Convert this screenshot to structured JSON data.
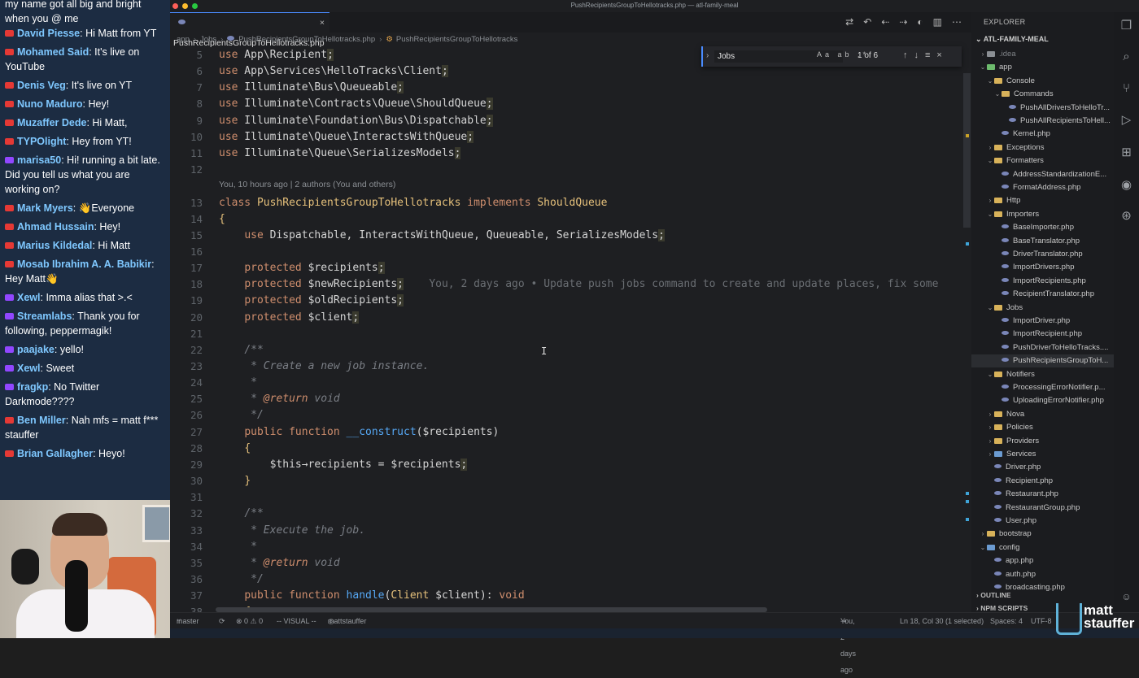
{
  "chat": {
    "intro": "my name got all big and bright when you @ me",
    "messages": [
      {
        "platform": "yt",
        "author": "David Piesse",
        "text": "Hi Matt from YT"
      },
      {
        "platform": "yt",
        "author": "Mohamed Said",
        "text": "It's live on YouTube"
      },
      {
        "platform": "yt",
        "author": "Denis Veg",
        "text": "It's live on YT"
      },
      {
        "platform": "yt",
        "author": "Nuno Maduro",
        "text": "Hey!"
      },
      {
        "platform": "yt",
        "author": "Muzaffer Dede",
        "text": "Hi Matt,"
      },
      {
        "platform": "yt",
        "author": "TYPOlight",
        "text": "Hey from YT!"
      },
      {
        "platform": "tw",
        "author": "marisa50",
        "text": "Hi! running a bit late. Did you tell us what you are working on?"
      },
      {
        "platform": "yt",
        "author": "Mark Myers",
        "text": "👋Everyone"
      },
      {
        "platform": "yt",
        "author": "Ahmad Hussain",
        "text": "Hey!"
      },
      {
        "platform": "yt",
        "author": "Marius Kildedal",
        "text": "Hi Matt"
      },
      {
        "platform": "yt",
        "author": "Mosab Ibrahim A. A. Babikir",
        "text": "Hey Matt👋"
      },
      {
        "platform": "tw",
        "author": "Xewl",
        "text": "Imma alias that >.<"
      },
      {
        "platform": "tw",
        "author": "Streamlabs",
        "text": "Thank you for following, peppermagik!"
      },
      {
        "platform": "tw",
        "author": "paajake",
        "text": "yello!"
      },
      {
        "platform": "tw",
        "author": "Xewl",
        "text": "Sweet"
      },
      {
        "platform": "tw",
        "author": "fragkp",
        "text": "No Twitter Darkmode????"
      },
      {
        "platform": "yt",
        "author": "Ben Miller",
        "text": "Nah mfs = matt f*** stauffer"
      },
      {
        "platform": "yt",
        "author": "Brian Gallagher",
        "text": "Heyo!"
      }
    ]
  },
  "window": {
    "title": "PushRecipientsGroupToHellotracks.php — atl-family-meal"
  },
  "tab": {
    "label": "PushRecipientsGroupToHellotracks.php"
  },
  "breadcrumb": [
    "app",
    "Jobs",
    "PushRecipientsGroupToHellotracks.php",
    "PushRecipientsGroupToHellotracks"
  ],
  "find": {
    "query": "Jobs",
    "count": "1 of 6"
  },
  "codelens": "You, 10 hours ago | 2 authors (You and others)",
  "blame": "You, 2 days ago • Update push jobs command to create and update places, fix some",
  "explorer": {
    "header": "EXPLORER",
    "project": "ATL-FAMILY-MEAL",
    "items": [
      {
        "label": ".idea",
        "depth": 1,
        "kind": "folder-gray",
        "arrow": "›",
        "muted": true
      },
      {
        "label": "app",
        "depth": 1,
        "kind": "folder-green",
        "arrow": "⌄"
      },
      {
        "label": "Console",
        "depth": 2,
        "kind": "folder",
        "arrow": "⌄"
      },
      {
        "label": "Commands",
        "depth": 3,
        "kind": "folder",
        "arrow": "⌄"
      },
      {
        "label": "PushAllDriversToHelloTr...",
        "depth": 4,
        "kind": "php"
      },
      {
        "label": "PushAllRecipientsToHell...",
        "depth": 4,
        "kind": "php"
      },
      {
        "label": "Kernel.php",
        "depth": 3,
        "kind": "php"
      },
      {
        "label": "Exceptions",
        "depth": 2,
        "kind": "folder",
        "arrow": "›"
      },
      {
        "label": "Formatters",
        "depth": 2,
        "kind": "folder",
        "arrow": "⌄"
      },
      {
        "label": "AddressStandardizationE...",
        "depth": 3,
        "kind": "php"
      },
      {
        "label": "FormatAddress.php",
        "depth": 3,
        "kind": "php"
      },
      {
        "label": "Http",
        "depth": 2,
        "kind": "folder",
        "arrow": "›"
      },
      {
        "label": "Importers",
        "depth": 2,
        "kind": "folder",
        "arrow": "⌄"
      },
      {
        "label": "BaseImporter.php",
        "depth": 3,
        "kind": "php"
      },
      {
        "label": "BaseTranslator.php",
        "depth": 3,
        "kind": "php"
      },
      {
        "label": "DriverTranslator.php",
        "depth": 3,
        "kind": "php"
      },
      {
        "label": "ImportDrivers.php",
        "depth": 3,
        "kind": "php"
      },
      {
        "label": "ImportRecipients.php",
        "depth": 3,
        "kind": "php"
      },
      {
        "label": "RecipientTranslator.php",
        "depth": 3,
        "kind": "php"
      },
      {
        "label": "Jobs",
        "depth": 2,
        "kind": "folder",
        "arrow": "⌄"
      },
      {
        "label": "ImportDriver.php",
        "depth": 3,
        "kind": "php"
      },
      {
        "label": "ImportRecipient.php",
        "depth": 3,
        "kind": "php"
      },
      {
        "label": "PushDriverToHelloTracks....",
        "depth": 3,
        "kind": "php"
      },
      {
        "label": "PushRecipientsGroupToH...",
        "depth": 3,
        "kind": "php",
        "selected": true
      },
      {
        "label": "Notifiers",
        "depth": 2,
        "kind": "folder",
        "arrow": "⌄"
      },
      {
        "label": "ProcessingErrorNotifier.p...",
        "depth": 3,
        "kind": "php"
      },
      {
        "label": "UploadingErrorNotifier.php",
        "depth": 3,
        "kind": "php"
      },
      {
        "label": "Nova",
        "depth": 2,
        "kind": "folder",
        "arrow": "›"
      },
      {
        "label": "Policies",
        "depth": 2,
        "kind": "folder",
        "arrow": "›"
      },
      {
        "label": "Providers",
        "depth": 2,
        "kind": "folder",
        "arrow": "›"
      },
      {
        "label": "Services",
        "depth": 2,
        "kind": "folder-blue",
        "arrow": "›"
      },
      {
        "label": "Driver.php",
        "depth": 2,
        "kind": "php"
      },
      {
        "label": "Recipient.php",
        "depth": 2,
        "kind": "php"
      },
      {
        "label": "Restaurant.php",
        "depth": 2,
        "kind": "php"
      },
      {
        "label": "RestaurantGroup.php",
        "depth": 2,
        "kind": "php"
      },
      {
        "label": "User.php",
        "depth": 2,
        "kind": "php"
      },
      {
        "label": "bootstrap",
        "depth": 1,
        "kind": "folder",
        "arrow": "›"
      },
      {
        "label": "config",
        "depth": 1,
        "kind": "folder-blue",
        "arrow": "⌄"
      },
      {
        "label": "app.php",
        "depth": 2,
        "kind": "php"
      },
      {
        "label": "auth.php",
        "depth": 2,
        "kind": "php"
      },
      {
        "label": "broadcasting.php",
        "depth": 2,
        "kind": "php"
      }
    ],
    "outline": "OUTLINE",
    "npm": "NPM SCRIPTS"
  },
  "status": {
    "branch": "master",
    "problems": "⊗ 0 ⚠ 0",
    "mode": "-- VISUAL --",
    "user": "mattstauffer",
    "blame": "You, 2 days ago",
    "position": "Ln 18, Col 30 (1 selected)",
    "spaces": "Spaces: 4",
    "encoding": "UTF-8"
  },
  "brand": {
    "line1": "matt",
    "line2": "stauffer"
  },
  "code": [
    {
      "n": "5",
      "html": "<span class='kw'>use</span> App\\Recipient<span class='semi'>;</span>"
    },
    {
      "n": "6",
      "html": "<span class='kw'>use</span> App\\Services\\HelloTracks\\Client<span class='semi'>;</span>"
    },
    {
      "n": "7",
      "html": "<span class='kw'>use</span> Illuminate\\Bus\\Queueable<span class='semi'>;</span>"
    },
    {
      "n": "8",
      "html": "<span class='kw'>use</span> Illuminate\\Contracts\\Queue\\ShouldQueue<span class='semi'>;</span>"
    },
    {
      "n": "9",
      "html": "<span class='kw'>use</span> Illuminate\\Foundation\\Bus\\Dispatchable<span class='semi'>;</span>"
    },
    {
      "n": "10",
      "html": "<span class='kw'>use</span> Illuminate\\Queue\\InteractsWithQueue<span class='semi'>;</span>"
    },
    {
      "n": "11",
      "html": "<span class='kw'>use</span> Illuminate\\Queue\\SerializesModels<span class='semi'>;</span>"
    },
    {
      "n": "12",
      "html": ""
    },
    {
      "n": "13",
      "html": "<span class='kw'>class</span> <span class='cls'>PushRecipientsGroupToHellotracks</span> <span class='kw'>implements</span> <span class='cls'>ShouldQueue</span>"
    },
    {
      "n": "14",
      "html": "<span class='cls'>{</span>"
    },
    {
      "n": "15",
      "html": "    <span class='kw'>use</span> Dispatchable, InteractsWithQueue, Queueable, SerializesModels<span class='semi'>;</span>"
    },
    {
      "n": "16",
      "html": ""
    },
    {
      "n": "17",
      "html": "    <span class='kw'>protected</span> $recipients<span class='semi'>;</span>"
    },
    {
      "n": "18",
      "html": "    <span class='kw'>protected</span> $newRecipients<span class='semi'>;</span>    <span class='blame'>You, 2 days ago • Update push jobs command to create and update places, fix some</span>"
    },
    {
      "n": "19",
      "html": "    <span class='kw'>protected</span> $oldRecipients<span class='semi'>;</span>"
    },
    {
      "n": "20",
      "html": "    <span class='kw'>protected</span> $client<span class='semi'>;</span>"
    },
    {
      "n": "21",
      "html": ""
    },
    {
      "n": "22",
      "html": "    <span class='cmt'>/**</span>"
    },
    {
      "n": "23",
      "html": "     <span class='cmt'>* Create a new job instance.</span>"
    },
    {
      "n": "24",
      "html": "     <span class='cmt'>*</span>"
    },
    {
      "n": "25",
      "html": "     <span class='cmt'>* </span><span class='tag'>@return</span> <span class='cmt'>void</span>"
    },
    {
      "n": "26",
      "html": "     <span class='cmt'>*/</span>"
    },
    {
      "n": "27",
      "html": "    <span class='kw'>public function</span> <span class='fn'>__construct</span>($recipients)"
    },
    {
      "n": "28",
      "html": "    <span class='cls'>{</span>"
    },
    {
      "n": "29",
      "html": "        $this→recipients = $recipients<span class='semi'>;</span>"
    },
    {
      "n": "30",
      "html": "    <span class='cls'>}</span>"
    },
    {
      "n": "31",
      "html": ""
    },
    {
      "n": "32",
      "html": "    <span class='cmt'>/**</span>"
    },
    {
      "n": "33",
      "html": "     <span class='cmt'>* Execute the job.</span>"
    },
    {
      "n": "34",
      "html": "     <span class='cmt'>*</span>"
    },
    {
      "n": "35",
      "html": "     <span class='cmt'>* </span><span class='tag'>@return</span> <span class='cmt'>void</span>"
    },
    {
      "n": "36",
      "html": "     <span class='cmt'>*/</span>"
    },
    {
      "n": "37",
      "html": "    <span class='kw'>public function</span> <span class='fn'>handle</span>(<span class='cls'>Client</span> $client): <span class='kw'>void</span>"
    },
    {
      "n": "38",
      "html": "    <span class='cls'>{</span>"
    }
  ]
}
